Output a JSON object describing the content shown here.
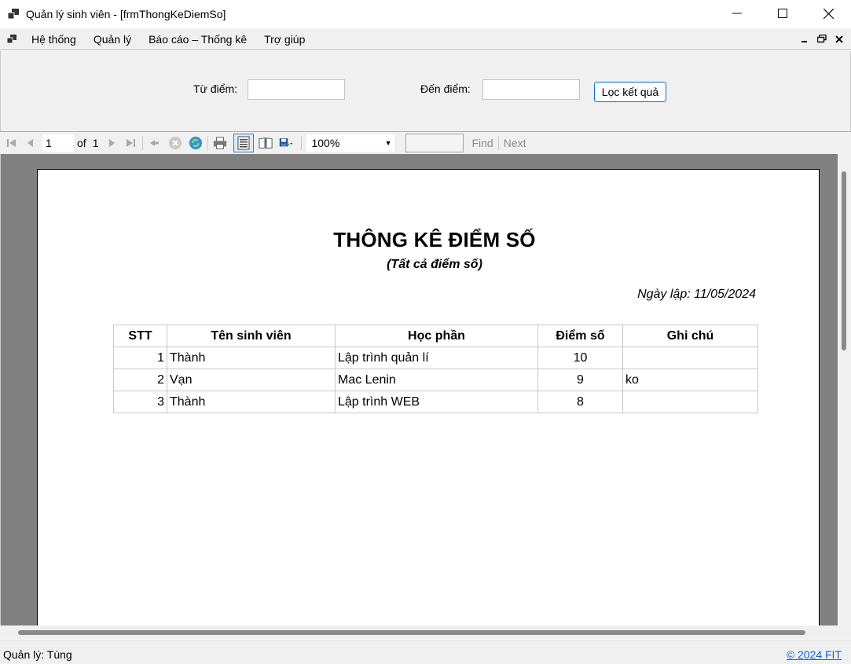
{
  "window": {
    "title": "Quản lý sinh viên - [frmThongKeDiemSo]",
    "minimize": "—",
    "maximize": "☐",
    "close": "✕"
  },
  "menu": {
    "items": [
      "Hệ thống",
      "Quản lý",
      "Báo cáo – Thống kê",
      "Trợ giúp"
    ],
    "mdi_controls": [
      "▁",
      "❐",
      "✕"
    ]
  },
  "filter": {
    "from_label": "Từ điểm:",
    "from_value": "",
    "to_label": "Đến điểm:",
    "to_value": "",
    "button_label": "Lọc kết quả"
  },
  "toolbar": {
    "page_current": "1",
    "page_of": "of",
    "page_total": "1",
    "zoom": "100%",
    "find_value": "",
    "find_label": "Find",
    "next_label": "Next",
    "icons": [
      "first-page-icon",
      "prev-page-icon",
      "next-page-icon",
      "last-page-icon",
      "back-icon",
      "stop-icon",
      "refresh-icon",
      "print-icon",
      "print-layout-icon",
      "page-setup-icon",
      "export-icon"
    ]
  },
  "report": {
    "title": "THÔNG KÊ ĐIỂM SỐ",
    "subtitle": "(Tất cả điểm số)",
    "date": "Ngày lập: 11/05/2024",
    "columns": [
      "STT",
      "Tên sinh viên",
      "Học phần",
      "Điểm số",
      "Ghi chú"
    ],
    "rows": [
      {
        "stt": "1",
        "name": "Thành",
        "course": "Lập trình quản lí",
        "score": "10",
        "note": ""
      },
      {
        "stt": "2",
        "name": "Vạn",
        "course": "Mac Lenin",
        "score": "9",
        "note": "ko"
      },
      {
        "stt": "3",
        "name": "Thành",
        "course": "Lập trình WEB",
        "score": "8",
        "note": ""
      }
    ]
  },
  "status": {
    "user": "Quản lý: Tùng",
    "copyright": "© 2024 FIT"
  },
  "colors": {
    "chrome": "#f0f0f0",
    "report_bg": "#808080",
    "link": "#0b5fd7",
    "button_border": "#0a6fcf"
  }
}
